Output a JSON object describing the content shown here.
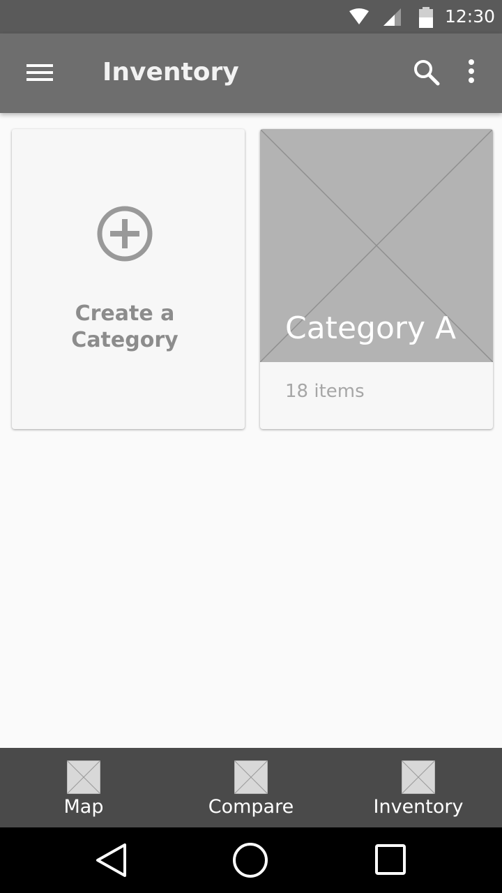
{
  "status_bar": {
    "time": "12:30",
    "icons": [
      "wifi-icon",
      "signal-icon",
      "battery-icon"
    ]
  },
  "app_bar": {
    "title": "Inventory",
    "icons": [
      "menu-icon",
      "search-icon",
      "more-vert-icon"
    ]
  },
  "cards": {
    "create": {
      "label": "Create a\nCategory",
      "icon": "add-circle-icon"
    },
    "category": {
      "title": "Category A",
      "count": "18 items"
    }
  },
  "bottom_nav": {
    "items": [
      {
        "label": "Map"
      },
      {
        "label": "Compare"
      },
      {
        "label": "Inventory"
      }
    ]
  },
  "system_nav": {
    "icons": [
      "back-icon",
      "home-icon",
      "recents-icon"
    ]
  },
  "colors": {
    "status_bar": "#5a5a5a",
    "app_bar": "#6e6e6e",
    "background": "#fafafa",
    "card": "#f7f7f7",
    "image_placeholder": "#b3b3b3",
    "bottom_nav": "#4a4a4a",
    "system_bar": "#000000"
  }
}
